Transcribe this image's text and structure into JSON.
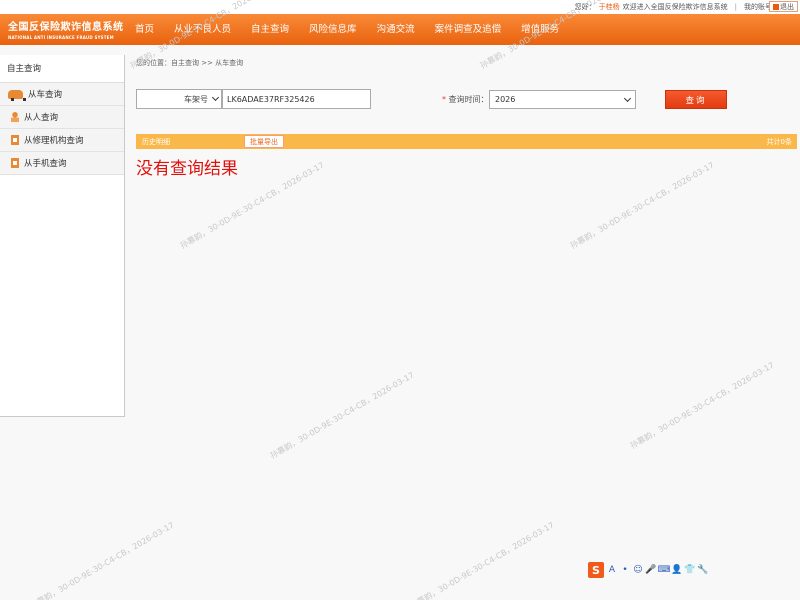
{
  "topbar": {
    "greeting": "您好：",
    "username": "于桂杨",
    "welcome": "欢迎进入全国反保险欺诈信息系统",
    "separator": "|",
    "account": "我的账号",
    "logout": "退出"
  },
  "header": {
    "logo_cn": "全国反保险欺诈信息系统",
    "logo_en": "NATIONAL ANTI INSURANCE FRAUD SYSTEM",
    "nav": [
      "首页",
      "从业不良人员",
      "自主查询",
      "风险信息库",
      "沟通交流",
      "案件调查及追偿",
      "增值服务"
    ]
  },
  "sidebar": {
    "title": "自主查询",
    "items": [
      {
        "label": "从车查询",
        "icon": "car-icon"
      },
      {
        "label": "从人查询",
        "icon": "person-icon"
      },
      {
        "label": "从修理机构查询",
        "icon": "repair-shop-icon"
      },
      {
        "label": "从手机查询",
        "icon": "phone-icon"
      }
    ]
  },
  "main": {
    "breadcrumb": "您的位置：自主查询 >> 从车查询",
    "field_type": "车架号",
    "vin_value": "LK6ADAE37RF325426",
    "time_star": "*",
    "time_label": "查询时间：",
    "year": "2026",
    "query_button": "查询",
    "results_label": "历史明细",
    "export_button": "批量导出",
    "count": "共计0条",
    "no_result": "没有查询结果"
  },
  "ime": {
    "logo": "S",
    "items": [
      "A",
      "•",
      "☺",
      "🎤",
      "⌨",
      "👤",
      "👕",
      "🔧"
    ]
  },
  "watermark": "孙慕韵，30-0D-9E-30-C4-CB，2026-03-17",
  "colors": {
    "brand_orange": "#e8620f",
    "result_bar": "#fbb84a",
    "no_result_red": "#e0110c",
    "query_button": "#e23b12"
  }
}
